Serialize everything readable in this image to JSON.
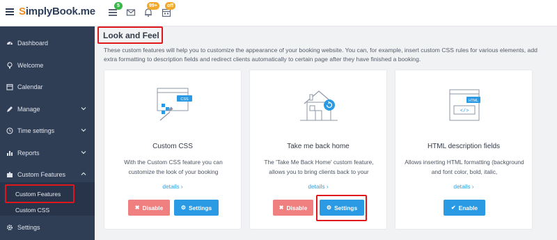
{
  "header": {
    "logo_prefix": "S",
    "logo_text": "implyBook.me",
    "badges": {
      "tasks": "5",
      "notifications": "99+",
      "calendar": "off"
    }
  },
  "sidebar": {
    "items": [
      {
        "label": "Dashboard",
        "icon": "dashboard-icon"
      },
      {
        "label": "Welcome",
        "icon": "lightbulb-icon"
      },
      {
        "label": "Calendar",
        "icon": "calendar-icon"
      },
      {
        "label": "Manage",
        "icon": "pencil-icon"
      },
      {
        "label": "Time settings",
        "icon": "clock-icon"
      },
      {
        "label": "Reports",
        "icon": "chart-icon"
      },
      {
        "label": "Custom Features",
        "icon": "puzzle-icon"
      },
      {
        "label": "Settings",
        "icon": "gear-icon"
      }
    ],
    "sub_items": [
      "Custom Features",
      "Custom CSS"
    ]
  },
  "main": {
    "title": "Look and Feel",
    "description": "These custom features will help you to customize the appearance of your booking website. You can, for example, insert custom CSS rules for various elements, add extra formatting to description fields and redirect clients automatically to certain page after they have finished a booking.",
    "cards": [
      {
        "title": "Custom CSS",
        "text": "With the Custom CSS feature you can customize the look of your booking",
        "details": "details",
        "disable_label": "Disable",
        "settings_label": "Settings"
      },
      {
        "title": "Take me back home",
        "text": "The 'Take Me Back Home' custom feature, allows you to bring clients back to your",
        "details": "details",
        "disable_label": "Disable",
        "settings_label": "Settings"
      },
      {
        "title": "HTML description fields",
        "text": "Allows inserting HTML formatting (background and font color, bold, italic,",
        "details": "details",
        "enable_label": "Enable"
      }
    ]
  },
  "colors": {
    "sidebar": "#2f3d55",
    "accent_blue": "#2a9ae4",
    "disable_red": "#f08080",
    "highlight_red": "#e0161d"
  }
}
